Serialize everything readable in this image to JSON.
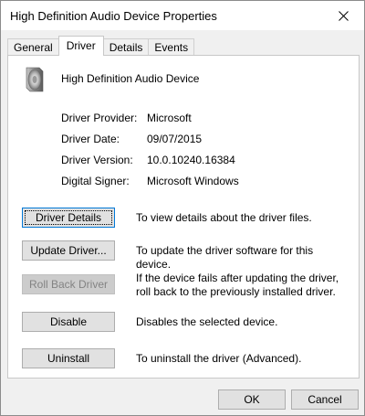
{
  "window": {
    "title": "High Definition Audio Device Properties"
  },
  "tabs": [
    {
      "label": "General",
      "active": false
    },
    {
      "label": "Driver",
      "active": true
    },
    {
      "label": "Details",
      "active": false
    },
    {
      "label": "Events",
      "active": false
    }
  ],
  "device": {
    "name": "High Definition Audio Device",
    "icon": "speaker-icon"
  },
  "info": [
    {
      "key": "Driver Provider:",
      "value": "Microsoft"
    },
    {
      "key": "Driver Date:",
      "value": "09/07/2015"
    },
    {
      "key": "Driver Version:",
      "value": "10.0.10240.16384"
    },
    {
      "key": "Digital Signer:",
      "value": "Microsoft Windows"
    }
  ],
  "actions": [
    {
      "label": "Driver Details",
      "desc": "To view details about the driver files.",
      "enabled": true
    },
    {
      "label": "Update Driver...",
      "desc": "To update the driver software for this device.",
      "enabled": true
    },
    {
      "label": "Roll Back Driver",
      "desc": "If the device fails after updating the driver, roll back to the previously installed driver.",
      "enabled": false
    },
    {
      "label": "Disable",
      "desc": "Disables the selected device.",
      "enabled": true
    },
    {
      "label": "Uninstall",
      "desc": "To uninstall the driver (Advanced).",
      "enabled": true
    }
  ],
  "footer": {
    "ok_label": "OK",
    "cancel_label": "Cancel"
  }
}
